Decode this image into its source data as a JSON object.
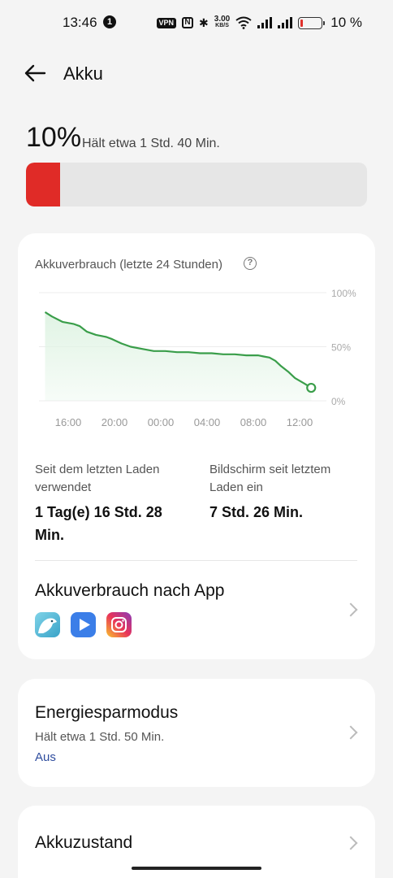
{
  "status_bar": {
    "time": "13:46",
    "notification_count": "1",
    "vpn": "VPN",
    "nfc": "N",
    "speed_value": "3.00",
    "speed_unit": "KB/S",
    "battery_percent": "10 %",
    "battery_level": 0.1
  },
  "header": {
    "title": "Akku"
  },
  "summary": {
    "percent": "10%",
    "remaining": "Hält etwa 1 Std. 40 Min.",
    "level": 0.1,
    "level_color": "#e02b27"
  },
  "usage_card": {
    "title": "Akkuverbrauch (letzte 24 Stunden)",
    "chart_data": {
      "type": "area",
      "title": "Akkuverbrauch (letzte 24 Stunden)",
      "x_ticks": [
        "16:00",
        "20:00",
        "00:00",
        "04:00",
        "08:00",
        "12:00"
      ],
      "y_ticks": [
        "100%",
        "50%",
        "0%"
      ],
      "ylim": [
        0,
        100
      ],
      "grid": true,
      "line_color": "#3a9e4a",
      "fill_color": "#dff3e3",
      "x": [
        14.0,
        14.6,
        15.5,
        16.5,
        17.0,
        17.6,
        18.4,
        19.3,
        19.8,
        20.6,
        21.4,
        22.4,
        23.4,
        24.4,
        25.4,
        26.4,
        27.4,
        28.4,
        29.4,
        30.4,
        31.4,
        32.4,
        32.9,
        33.4,
        33.9,
        34.4,
        35.0,
        35.6,
        36.4,
        37.0
      ],
      "values": [
        82,
        78,
        73,
        71,
        69,
        64,
        61,
        59,
        57,
        53,
        50,
        48,
        46,
        46,
        45,
        45,
        44,
        44,
        43,
        43,
        42,
        42,
        41,
        40,
        37,
        32,
        27,
        21,
        16,
        12
      ]
    },
    "stats": [
      {
        "label": "Seit dem letzten Laden verwendet",
        "value": "1 Tag(e) 16 Std. 28 Min."
      },
      {
        "label": "Bildschirm seit letztem Laden ein",
        "value": "7 Std. 26 Min."
      }
    ],
    "app_usage_title": "Akkuverbrauch nach App",
    "apps": [
      {
        "icon": "bird-app-icon"
      },
      {
        "icon": "video-player-icon"
      },
      {
        "icon": "instagram-icon"
      }
    ]
  },
  "saver_card": {
    "title": "Energiesparmodus",
    "subtitle": "Hält etwa 1 Std. 50 Min.",
    "status": "Aus",
    "status_color": "#2f4d9e"
  },
  "health_card": {
    "title": "Akkuzustand"
  }
}
